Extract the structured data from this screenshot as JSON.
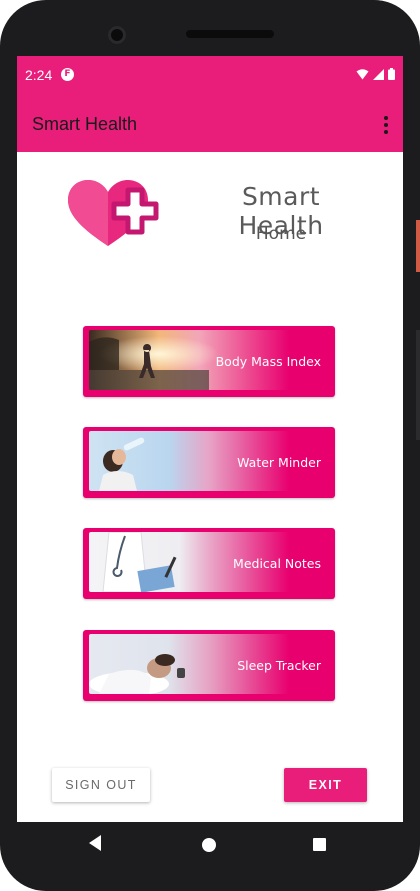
{
  "status": {
    "time": "2:24"
  },
  "appbar": {
    "title": "Smart Health"
  },
  "header": {
    "title": "Smart Health",
    "subtitle": "Home"
  },
  "menu": [
    {
      "label": "Body Mass Index",
      "icon": "runner-photo"
    },
    {
      "label": "Water Minder",
      "icon": "drinking-photo"
    },
    {
      "label": "Medical Notes",
      "icon": "doctor-photo"
    },
    {
      "label": "Sleep Tracker",
      "icon": "sleeping-photo"
    }
  ],
  "actions": {
    "sign_out": "SIGN OUT",
    "exit": "EXIT"
  },
  "colors": {
    "primary": "#e91e7a",
    "card": "#e8006f",
    "text": "#5a5a5a"
  }
}
